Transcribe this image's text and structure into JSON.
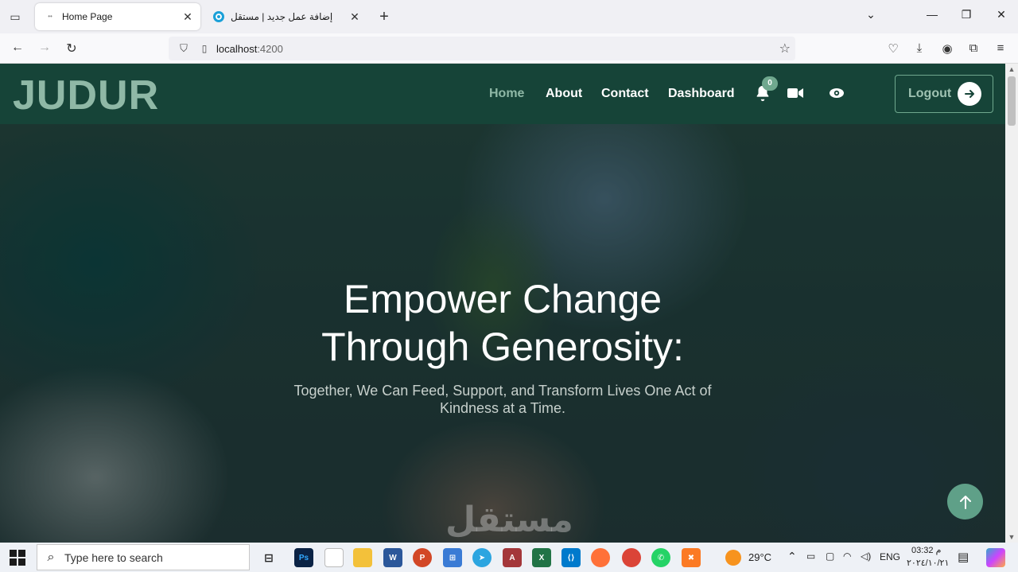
{
  "browser": {
    "tabs": [
      {
        "title": "Home Page",
        "active": true
      },
      {
        "title": "إضافة عمل جديد | مستقل",
        "active": false
      }
    ],
    "url_host": "localhost",
    "url_port": ":4200"
  },
  "site": {
    "brand": "JUDUR",
    "menu": [
      {
        "label": "Home",
        "current": true
      },
      {
        "label": "About",
        "current": false
      },
      {
        "label": "Contact",
        "current": false
      },
      {
        "label": "Dashboard",
        "current": false
      }
    ],
    "notification_count": "0",
    "logout_label": "Logout"
  },
  "hero": {
    "title_line1": "Empower Change",
    "title_line2": "Through Generosity:",
    "subtitle": "Together, We Can Feed, Support, and Transform Lives One Act of Kindness at a Time."
  },
  "watermark": "مستقل",
  "taskbar": {
    "search_placeholder": "Type here to search",
    "weather": "29°C",
    "language": "ENG",
    "time": "03:32 م",
    "date": "٢٠٢٤/١٠/٢١"
  },
  "colors": {
    "nav_bg": "#164438",
    "brand_accent": "#8fb8a6",
    "button_accent": "#5fa088"
  }
}
